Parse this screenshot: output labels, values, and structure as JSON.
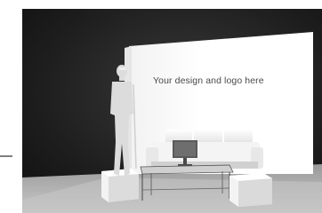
{
  "backwall": {
    "text": "Your design and logo here"
  },
  "colors": {
    "room_dark": "#1b1b1b",
    "room_mid": "#2b2b2b",
    "wall_white": "#ffffff",
    "floor": "#b8b8b8",
    "figure": "#d9d9d9"
  }
}
